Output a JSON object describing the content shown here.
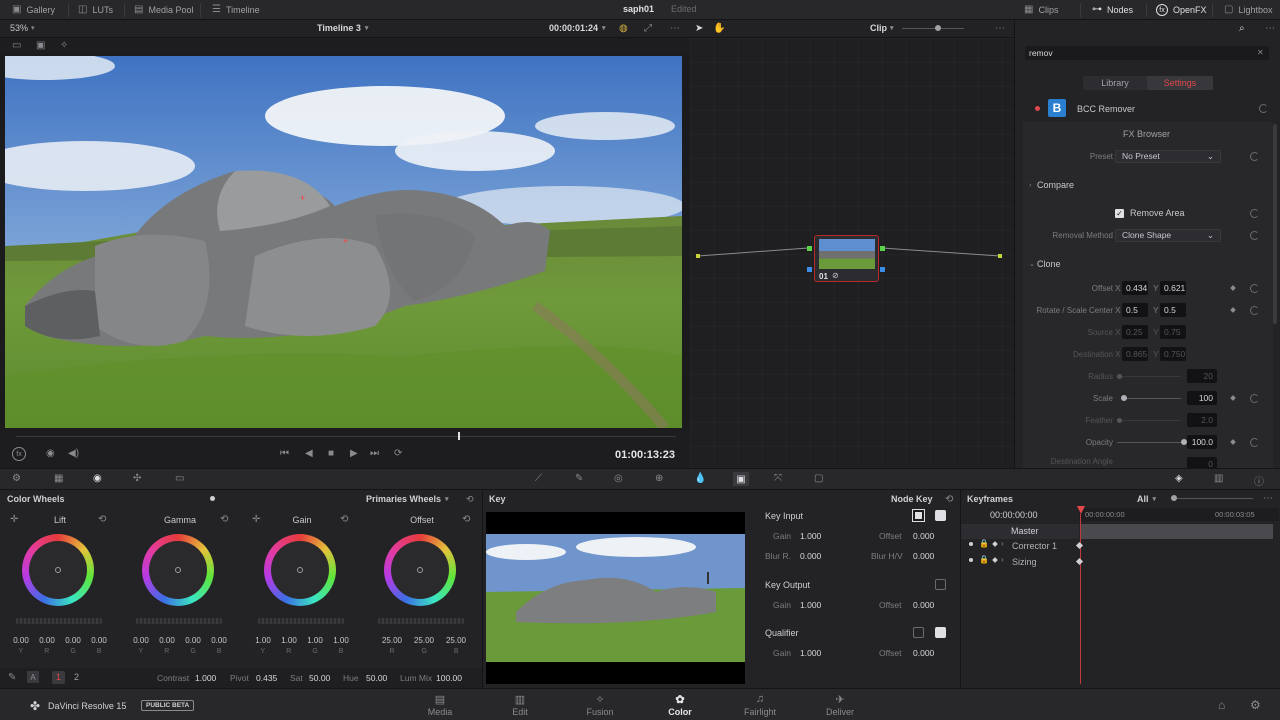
{
  "topbar": {
    "gallery": "Gallery",
    "luts": "LUTs",
    "media_pool": "Media Pool",
    "timeline": "Timeline",
    "project_name": "saph01",
    "project_status": "Edited",
    "clips": "Clips",
    "nodes": "Nodes",
    "openfx": "OpenFX",
    "lightbox": "Lightbox"
  },
  "viewer": {
    "zoom": "53%",
    "timeline_name": "Timeline 3",
    "timecode_small": "00:00:01:24",
    "timecode": "01:00:13:23",
    "playhead_fraction": 0.67
  },
  "nodes": {
    "mode": "Clip",
    "node_label": "01"
  },
  "openfx_panel": {
    "search_value": "remov",
    "tab_library": "Library",
    "tab_settings": "Settings",
    "plugin_name": "BCC Remover",
    "fx_browser": "FX Browser",
    "preset_label": "Preset",
    "preset_value": "No Preset",
    "compare": "Compare",
    "remove_area": "Remove Area",
    "removal_method_label": "Removal Method",
    "removal_method_value": "Clone Shape",
    "clone": "Clone",
    "offset_label": "Offset",
    "offset_x": "0.434",
    "offset_y": "0.621",
    "rotate_label": "Rotate / Scale Center",
    "rotate_x": "0.5",
    "rotate_y": "0.5",
    "source_label": "Source",
    "source_x": "0.25",
    "source_y": "0.75",
    "destination_label": "Destination",
    "destination_x": "0.865",
    "destination_y": "0.750",
    "radius_label": "Radius",
    "radius_value": "20",
    "scale_label": "Scale",
    "scale_value": "100",
    "feather_label": "Feather",
    "feather_value": "2.0",
    "opacity_label": "Opacity",
    "opacity_value": "100.0",
    "dest_angle_label": "Destination Angle",
    "dest_angle_value": "0",
    "x_label": "X",
    "y_label": "Y"
  },
  "color_wheels": {
    "title": "Color Wheels",
    "mode": "Primaries Wheels",
    "wheels": [
      {
        "name": "Lift",
        "values": [
          "0.00",
          "0.00",
          "0.00",
          "0.00"
        ],
        "channels": [
          "Y",
          "R",
          "G",
          "B"
        ]
      },
      {
        "name": "Gamma",
        "values": [
          "0.00",
          "0.00",
          "0.00",
          "0.00"
        ],
        "channels": [
          "Y",
          "R",
          "G",
          "B"
        ]
      },
      {
        "name": "Gain",
        "values": [
          "1.00",
          "1.00",
          "1.00",
          "1.00"
        ],
        "channels": [
          "Y",
          "R",
          "G",
          "B"
        ]
      },
      {
        "name": "Offset",
        "values": [
          "25.00",
          "25.00",
          "25.00"
        ],
        "channels": [
          "R",
          "G",
          "B"
        ]
      }
    ],
    "page1": "1",
    "page2": "2",
    "contrast_label": "Contrast",
    "contrast_value": "1.000",
    "pivot_label": "Pivot",
    "pivot_value": "0.435",
    "sat_label": "Sat",
    "sat_value": "50.00",
    "hue_label": "Hue",
    "hue_value": "50.00",
    "lummix_label": "Lum Mix",
    "lummix_value": "100.00"
  },
  "key": {
    "title": "Key",
    "node_key": "Node Key",
    "key_input": "Key Input",
    "gain_label": "Gain",
    "gain_value": "1.000",
    "offset_label": "Offset",
    "offset_value": "0.000",
    "blur_r_label": "Blur R.",
    "blur_r_value": "0.000",
    "blur_hv_label": "Blur H/V",
    "blur_hv_value": "0.000",
    "key_output": "Key Output",
    "out_gain_value": "1.000",
    "out_offset_value": "0.000",
    "qualifier": "Qualifier",
    "q_gain_value": "1.000",
    "q_offset_value": "0.000"
  },
  "keyframes": {
    "title": "Keyframes",
    "filter": "All",
    "timecode_left": "00:00:00:00",
    "timecode_mid": "00:00:00:00",
    "timecode_right": "00:00:03:05",
    "master": "Master",
    "tracks": [
      "Corrector 1",
      "Sizing"
    ]
  },
  "bottomnav": {
    "app_name": "DaVinci Resolve 15",
    "beta_badge": "PUBLIC BETA",
    "pages": [
      "Media",
      "Edit",
      "Fusion",
      "Color",
      "Fairlight",
      "Deliver"
    ],
    "active_page": "Color"
  },
  "colors": {
    "accent": "#e0484a",
    "active_nav": "#e6e6ea"
  }
}
